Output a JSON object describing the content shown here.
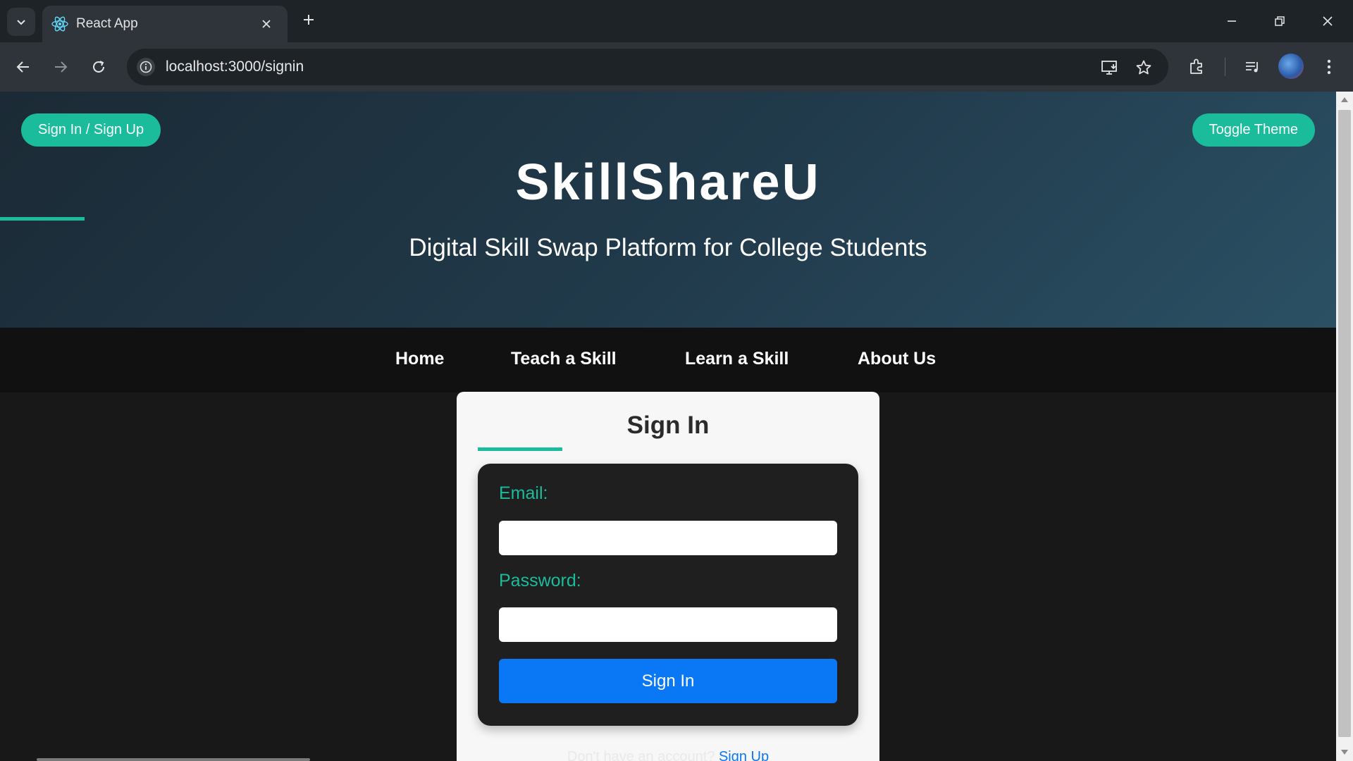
{
  "browser": {
    "tab_title": "React App",
    "url": "localhost:3000/signin"
  },
  "header": {
    "auth_button": "Sign In / Sign Up",
    "theme_button": "Toggle Theme",
    "title": "SkillShareU",
    "subtitle": "Digital Skill Swap Platform for College Students"
  },
  "nav": {
    "items": [
      {
        "label": "Home"
      },
      {
        "label": "Teach a Skill"
      },
      {
        "label": "Learn a Skill"
      },
      {
        "label": "About Us"
      }
    ]
  },
  "signin": {
    "title": "Sign In",
    "email_label": "Email:",
    "email_value": "",
    "password_label": "Password:",
    "password_value": "",
    "submit_label": "Sign In",
    "signup_prompt": "Don't have an account?",
    "signup_link": "Sign Up"
  },
  "colors": {
    "accent": "#1abc9c",
    "primary_button": "#0a78f5",
    "hero_gradient_start": "#1b2a35",
    "hero_gradient_end": "#2b5064",
    "nav_background": "#111111",
    "page_background": "#181818"
  }
}
